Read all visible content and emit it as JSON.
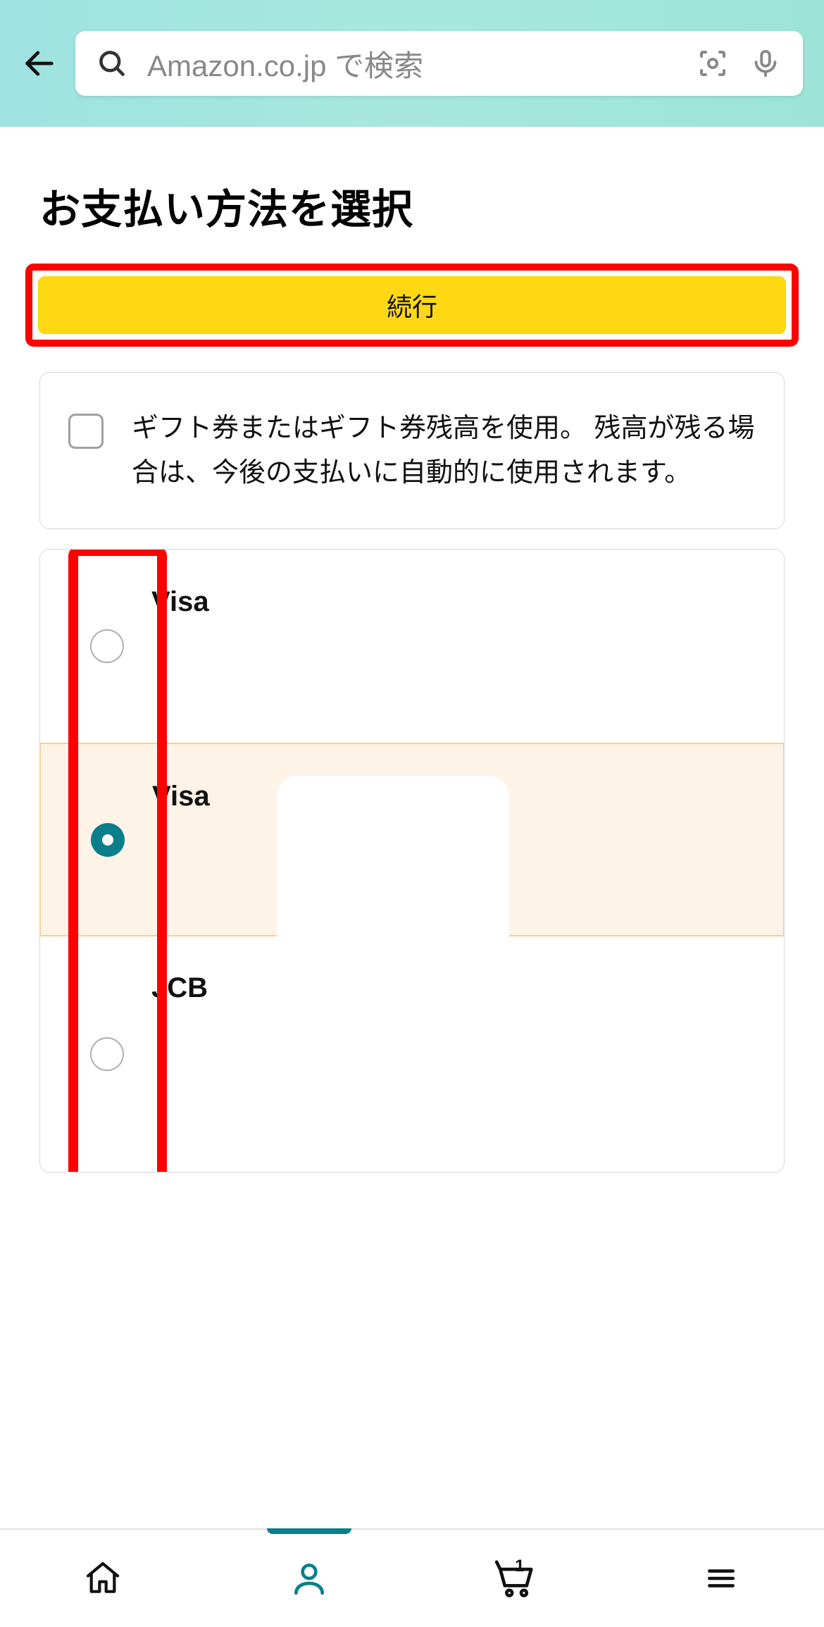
{
  "header": {
    "search_placeholder": "Amazon.co.jp で検索"
  },
  "page": {
    "title": "お支払い方法を選択",
    "continue_label": "続行"
  },
  "gift_card": {
    "text": "ギフト券またはギフト券残高を使用。 残高が残る場合は、今後の支払いに自動的に使用されます。"
  },
  "payments": [
    {
      "label": "Visa",
      "selected": false
    },
    {
      "label": "Visa",
      "selected": true
    },
    {
      "label": "JCB",
      "selected": false
    }
  ],
  "nav": {
    "cart_count": "1"
  }
}
